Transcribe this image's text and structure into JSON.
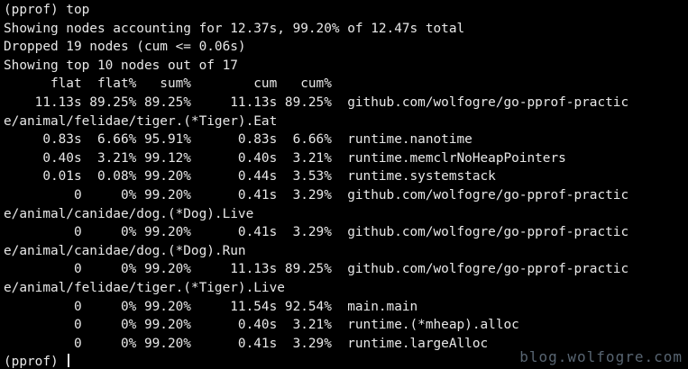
{
  "terminal": {
    "lines": [
      "(pprof) top",
      "Showing nodes accounting for 12.37s, 99.20% of 12.47s total",
      "Dropped 19 nodes (cum <= 0.06s)",
      "Showing top 10 nodes out of 17",
      "      flat  flat%   sum%        cum   cum%",
      "    11.13s 89.25% 89.25%     11.13s 89.25%  github.com/wolfogre/go-pprof-practic",
      "e/animal/felidae/tiger.(*Tiger).Eat",
      "     0.83s  6.66% 95.91%      0.83s  6.66%  runtime.nanotime",
      "     0.40s  3.21% 99.12%      0.40s  3.21%  runtime.memclrNoHeapPointers",
      "     0.01s  0.08% 99.20%      0.44s  3.53%  runtime.systemstack",
      "         0     0% 99.20%      0.41s  3.29%  github.com/wolfogre/go-pprof-practic",
      "e/animal/canidae/dog.(*Dog).Live",
      "         0     0% 99.20%      0.41s  3.29%  github.com/wolfogre/go-pprof-practic",
      "e/animal/canidae/dog.(*Dog).Run",
      "         0     0% 99.20%     11.13s 89.25%  github.com/wolfogre/go-pprof-practic",
      "e/animal/felidae/tiger.(*Tiger).Live",
      "         0     0% 99.20%     11.54s 92.54%  main.main",
      "         0     0% 99.20%      0.40s  3.21%  runtime.(*mheap).alloc",
      "         0     0% 99.20%      0.41s  3.29%  runtime.largeAlloc"
    ],
    "prompt": "(pprof) ",
    "watermark": "blog.wolfogre.com",
    "colors": {
      "background": "#000000",
      "foreground": "#e8e8e8",
      "watermark": "#6f7f8f"
    }
  }
}
